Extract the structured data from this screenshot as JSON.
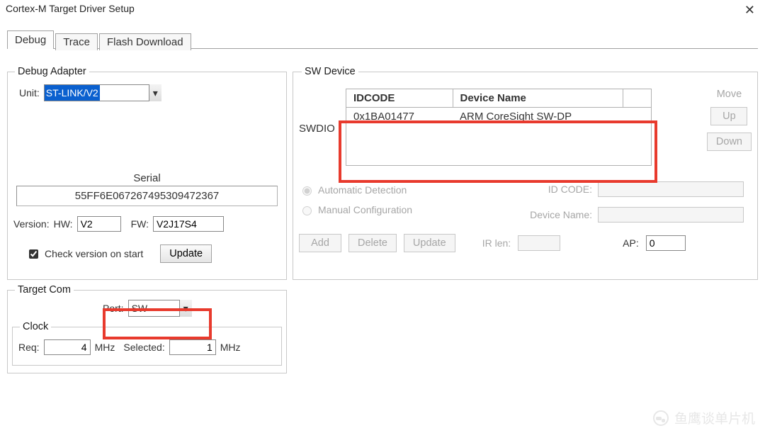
{
  "window": {
    "title": "Cortex-M Target Driver Setup"
  },
  "tabs": {
    "debug": "Debug",
    "trace": "Trace",
    "flash": "Flash Download",
    "active": "Debug"
  },
  "debugAdapter": {
    "legend": "Debug Adapter",
    "unitLabel": "Unit:",
    "unitValue": "ST-LINK/V2",
    "serialLabel": "Serial",
    "serialValue": "55FF6E067267495309472367",
    "versionLabel": "Version:",
    "hwLabel": "HW:",
    "hwValue": "V2",
    "fwLabel": "FW:",
    "fwValue": "V2J17S4",
    "checkLabel": "Check version on start",
    "updateLabel": "Update"
  },
  "targetCom": {
    "legend": "Target Com",
    "portLabel": "Port:",
    "portValue": "SW",
    "clock": {
      "legend": "Clock",
      "reqLabel": "Req:",
      "reqValue": "4",
      "reqUnit": "MHz",
      "selLabel": "Selected:",
      "selValue": "1",
      "selUnit": "MHz"
    }
  },
  "swDevice": {
    "legend": "SW Device",
    "swdioLabel": "SWDIO",
    "colIdcode": "IDCODE",
    "colDevname": "Device Name",
    "row": {
      "idcode": "0x1BA01477",
      "devname": "ARM CoreSight SW-DP"
    },
    "moveLabel": "Move",
    "upLabel": "Up",
    "downLabel": "Down",
    "autoDetect": "Automatic Detection",
    "manualConf": "Manual Configuration",
    "idCodeLabel": "ID CODE:",
    "devNameLabel": "Device Name:",
    "addLabel": "Add",
    "deleteLabel": "Delete",
    "updateLabel": "Update",
    "irLenLabel": "IR len:",
    "apLabel": "AP:",
    "apValue": "0"
  },
  "watermark": "鱼鹰谈单片机"
}
